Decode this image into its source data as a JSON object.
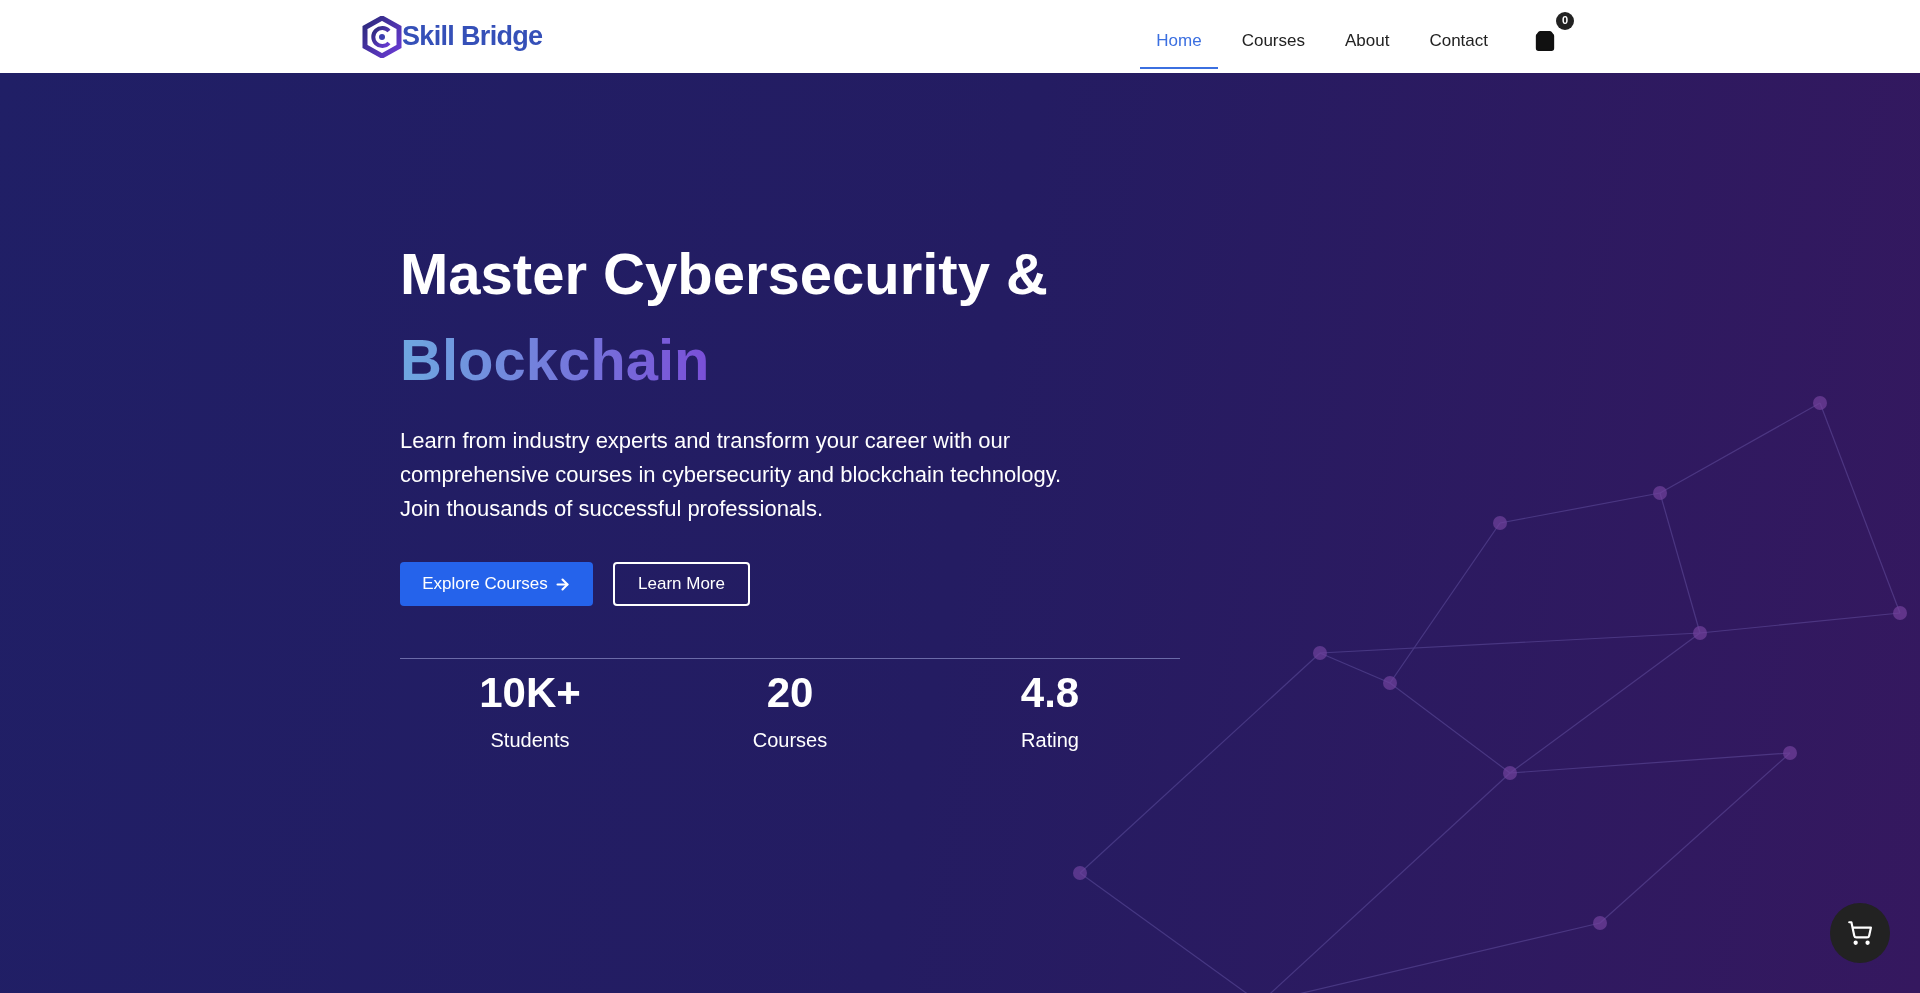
{
  "header": {
    "logo": "Skill Bridge",
    "nav": [
      {
        "label": "Home",
        "selected": true
      },
      {
        "label": "Courses",
        "selected": false
      },
      {
        "label": "About",
        "selected": false
      },
      {
        "label": "Contact",
        "selected": false
      }
    ],
    "cart_count": "0"
  },
  "hero": {
    "title": "Master Cybersecurity &",
    "highlight": "Blockchain",
    "description": "Learn from industry experts and transform your career with our comprehensive courses in cybersecurity and blockchain technology. Join thousands of successful professionals.",
    "buttons": [
      {
        "label": "Explore Courses",
        "kind": "primary"
      },
      {
        "label": "Learn More",
        "kind": "outline"
      }
    ],
    "stats": [
      {
        "value": "10K+",
        "label": "Students"
      },
      {
        "value": "20",
        "label": "Courses"
      },
      {
        "value": "4.8",
        "label": "Rating"
      }
    ]
  }
}
